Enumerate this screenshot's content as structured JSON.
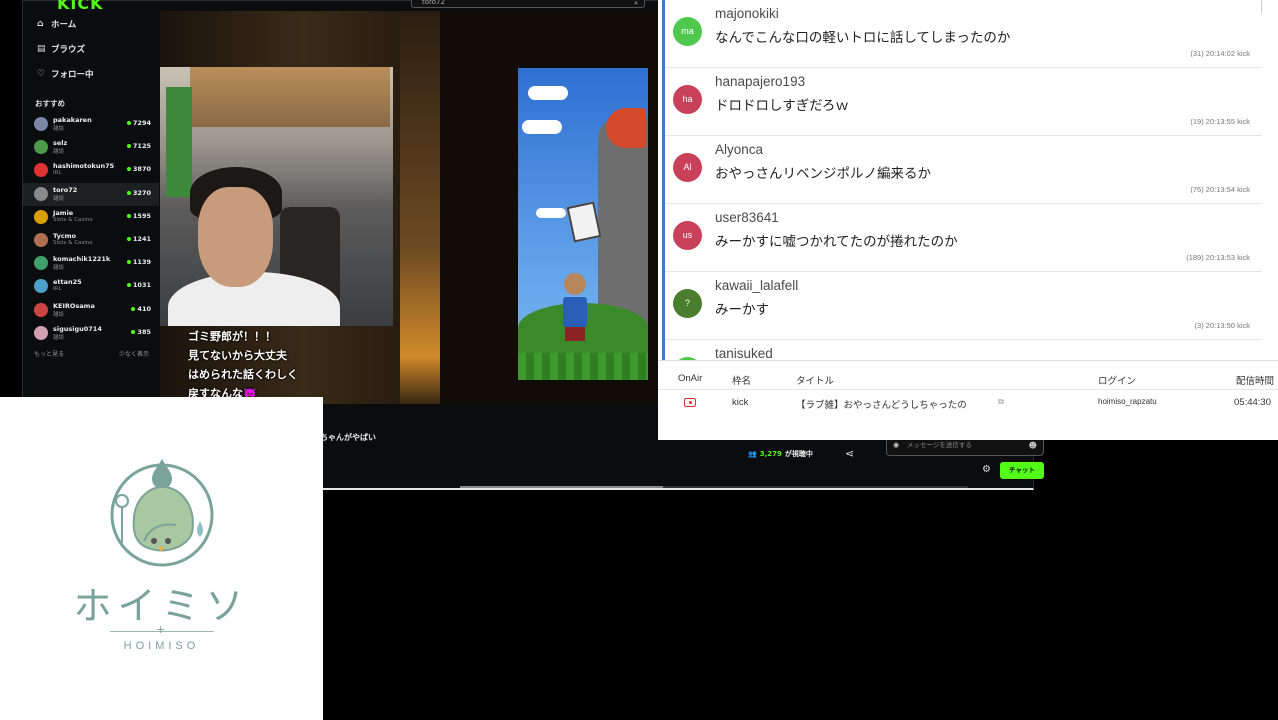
{
  "kick": {
    "logo": "KICK",
    "search_value": "toro72",
    "nav": [
      {
        "label": "ホーム",
        "icon": "home-icon"
      },
      {
        "label": "ブラウズ",
        "icon": "browse-icon"
      },
      {
        "label": "フォロー中",
        "icon": "heart-icon"
      }
    ],
    "recommended_title": "おすすめ",
    "channels": [
      {
        "name": "pakakaren",
        "category": "雑談",
        "viewers": "7294",
        "color": "#7a86a8"
      },
      {
        "name": "selz",
        "category": "雑談",
        "viewers": "7125",
        "color": "#4a9a4a"
      },
      {
        "name": "hashimotokun75",
        "category": "IRL",
        "viewers": "3870",
        "color": "#d33"
      },
      {
        "name": "toro72",
        "category": "雑談",
        "viewers": "3270",
        "color": "#8a8a8a"
      },
      {
        "name": "Jamie",
        "category": "Slots & Casino",
        "viewers": "1595",
        "color": "#d8a000"
      },
      {
        "name": "Tycmo",
        "category": "Slots & Casino",
        "viewers": "1241",
        "color": "#b07050"
      },
      {
        "name": "komachik1221k",
        "category": "雑談",
        "viewers": "1139",
        "color": "#3fa06a"
      },
      {
        "name": "ettan25",
        "category": "IRL",
        "viewers": "1031",
        "color": "#4aa0c8"
      },
      {
        "name": "KEIROsama",
        "category": "雑談",
        "viewers": "410",
        "color": "#c44"
      },
      {
        "name": "sigusigu0714",
        "category": "雑談",
        "viewers": "385",
        "color": "#d0a0b0"
      }
    ],
    "show_more": "もっと見る",
    "show_less": "少なく表示",
    "overlay_lines": [
      "ゴミ野郎が！！！",
      "見てないから大丈夫",
      "はめられた話くわしく",
      "戻すなんな👿"
    ],
    "stream_tag": "ちゃんがやばい",
    "viewers_count": "3,279",
    "viewers_suffix": "が視聴中",
    "chat_placeholder": "メッセージを送信する",
    "chat_button": "チャット",
    "playback_progress": 0.4
  },
  "comments": [
    {
      "avatar": "ma",
      "avatar_color": "#4ec94e",
      "user": "majonokiki",
      "text": "なんでこんな口の軽いトロに話してしまったのか",
      "meta": "(31)  20:14:02  kick"
    },
    {
      "avatar": "ha",
      "avatar_color": "#c8405a",
      "user": "hanapajero193",
      "text": "ドロドロしすぎだろｗ",
      "meta": "(19)  20:13:55  kick"
    },
    {
      "avatar": "Al",
      "avatar_color": "#c8405a",
      "user": "Alyonca",
      "text": "おやっさんリベンジポルノ編来るか",
      "meta": "(76)  20:13:54  kick"
    },
    {
      "avatar": "us",
      "avatar_color": "#c8405a",
      "user": "user83641",
      "text": "みーかすに嘘つかれてたのが捲れたのか",
      "meta": "(189)  20:13:53  kick"
    },
    {
      "avatar": "?",
      "avatar_color": "#4a7d2e",
      "user": "kawaii_lalafell",
      "text": "みーかす",
      "meta": "(3)  20:13:50  kick"
    },
    {
      "avatar": "ta",
      "avatar_color": "#4ec94e",
      "user": "tanisuked",
      "text": "",
      "meta": ""
    }
  ],
  "table": {
    "headers": {
      "onair": "OnAir",
      "service": "枠名",
      "title": "タイトル",
      "login": "ログイン",
      "time": "配信時間"
    },
    "row": {
      "service": "kick",
      "title": "【ラブ雑】おやっさんどうしちゃったの",
      "login": "hoimiso_rapzatu",
      "time": "05:44:30"
    }
  },
  "logo": {
    "text": "ホイミソ",
    "sub": "HOIMISO",
    "color": "#7aa39a"
  }
}
